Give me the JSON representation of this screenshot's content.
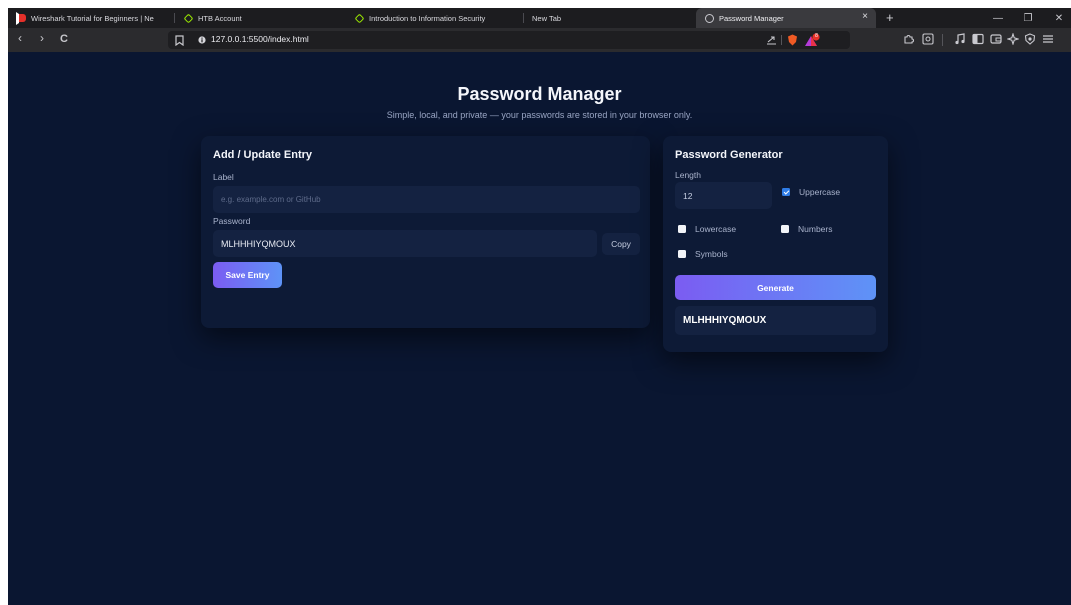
{
  "browser": {
    "tabs": [
      {
        "title": "Wireshark Tutorial for Beginners | Ne",
        "icon": "youtube-icon",
        "active": false
      },
      {
        "title": "HTB Account",
        "icon": "htb-cube-icon",
        "active": false
      },
      {
        "title": "Introduction to Information Security",
        "icon": "htb-cube-icon",
        "active": false
      },
      {
        "title": "New Tab",
        "icon": "none",
        "active": false
      },
      {
        "title": "Password Manager",
        "icon": "globe-icon",
        "active": true
      }
    ],
    "tab_close": "×",
    "new_tab": "+",
    "window_controls": {
      "minimize": "—",
      "restore": "❐",
      "close": "✕"
    },
    "nav": {
      "back": "‹",
      "forward": "›",
      "reload": "C"
    },
    "url": "127.0.0.1:5500/index.html",
    "badge_count": "8",
    "accent": "#7b5cf2",
    "background": "#0a1631"
  },
  "page": {
    "title": "Password Manager",
    "subtitle": "Simple, local, and private — your passwords are stored in your browser only."
  },
  "entry_card": {
    "title": "Add / Update Entry",
    "label_field": {
      "label": "Label",
      "placeholder": "e.g. example.com or GitHub",
      "value": ""
    },
    "password_field": {
      "label": "Password",
      "value": "MLHHHIYQMOUX"
    },
    "copy_label": "Copy",
    "save_label": "Save Entry"
  },
  "generator_card": {
    "title": "Password Generator",
    "length_label": "Length",
    "length_value": "12",
    "options": {
      "uppercase": {
        "label": "Uppercase",
        "checked": true
      },
      "lowercase": {
        "label": "Lowercase",
        "checked": false
      },
      "numbers": {
        "label": "Numbers",
        "checked": false
      },
      "symbols": {
        "label": "Symbols",
        "checked": false
      }
    },
    "generate_label": "Generate",
    "output": "MLHHHIYQMOUX"
  }
}
